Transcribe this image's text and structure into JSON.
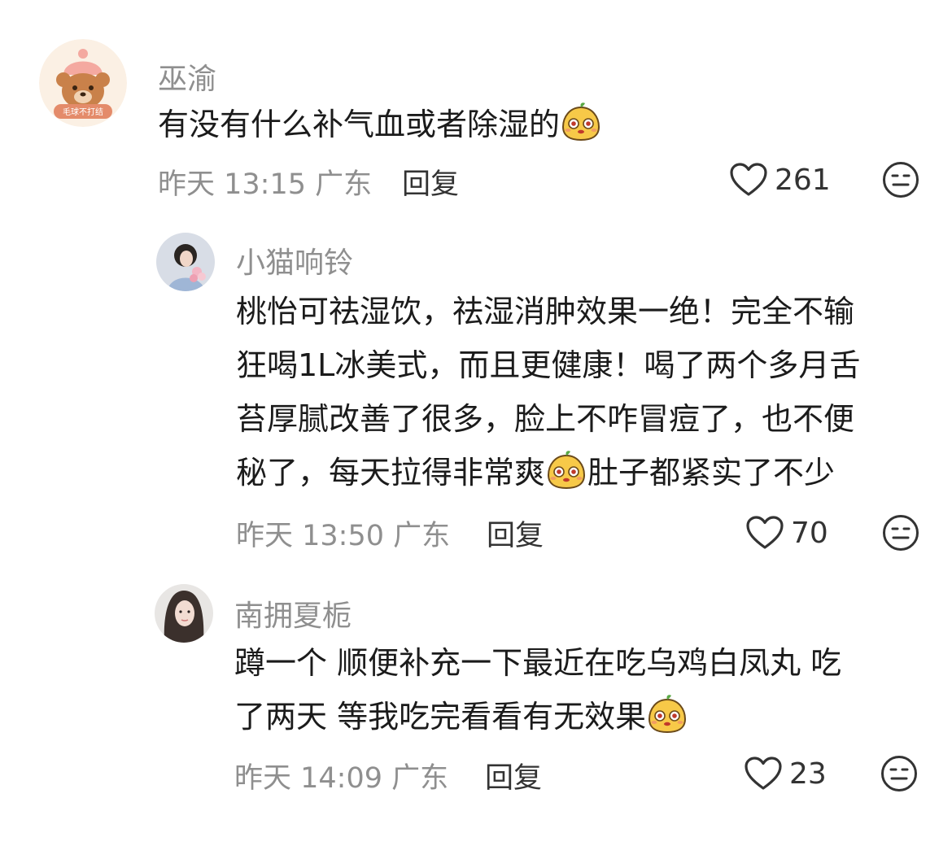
{
  "comments": [
    {
      "username": "巫渝",
      "avatar_badge": "毛球不打结",
      "text_lines": [
        "有没有什么补气血或者除湿的"
      ],
      "time": "昨天 13:15 广东",
      "reply_label": "回复",
      "likes": "261"
    },
    {
      "username": "小猫响铃",
      "text_lines": [
        "桃怡可祛湿饮，祛湿消肿效果一绝！完全不输",
        "狂喝1L冰美式，而且更健康！喝了两个多月舌",
        "苔厚腻改善了很多，脸上不咋冒痘了，也不便",
        "秘了，每天拉得非常爽",
        "肚子都紧实了不少"
      ],
      "time": "昨天 13:50 广东",
      "reply_label": "回复",
      "likes": "70"
    },
    {
      "username": "南拥夏栀",
      "text_lines": [
        "蹲一个 顺便补充一下最近在吃乌鸡白凤丸 吃",
        "了两天 等我吃完看看有无效果"
      ],
      "time": "昨天 14:09 广东",
      "reply_label": "回复",
      "likes": "23"
    }
  ],
  "icons": {
    "like": "heart-outline-icon",
    "dislike": "meh-face-icon",
    "emoji": "yellow-blob-emoji"
  },
  "colors": {
    "text": "#1b1b1b",
    "muted": "#8f8f8f",
    "emoji_yellow": "#f7c948"
  }
}
